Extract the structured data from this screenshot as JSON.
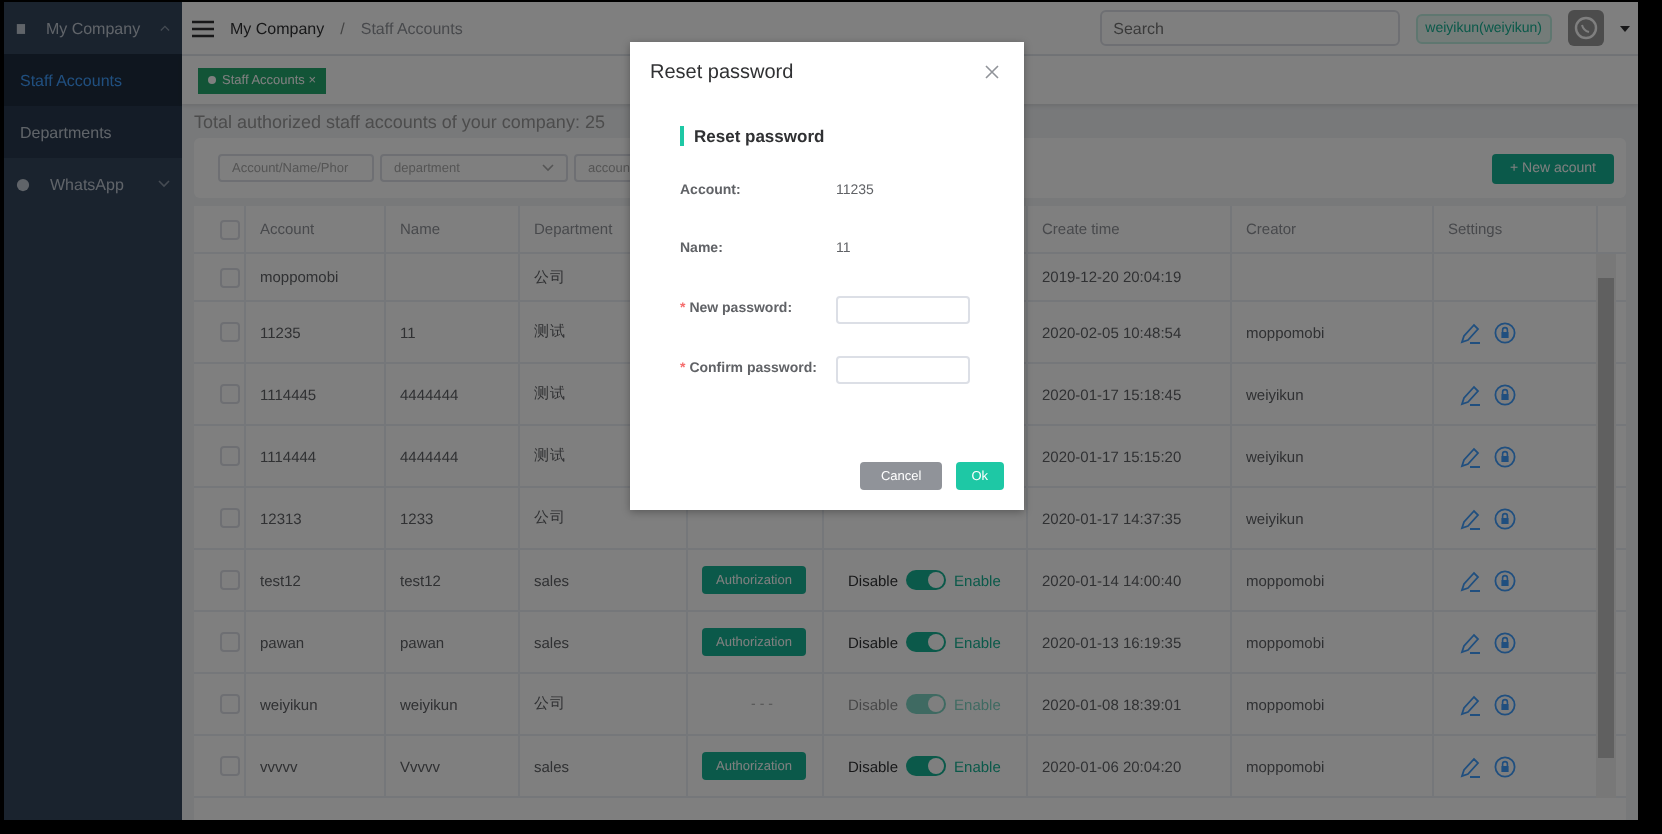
{
  "sidebar": {
    "items": [
      {
        "label": "My Company",
        "kind": "group",
        "expanded": true,
        "selected": false
      },
      {
        "label": "Staff Accounts",
        "kind": "sub",
        "selected": true
      },
      {
        "label": "Departments",
        "kind": "sub",
        "selected": false
      },
      {
        "label": "WhatsApp",
        "kind": "group",
        "expanded": false,
        "selected": false
      }
    ]
  },
  "header": {
    "breadcrumb": [
      "My Company",
      "Staff Accounts"
    ],
    "separator": "/",
    "search": {
      "placeholder": "Search"
    },
    "user": "weiyikun(weiyikun)"
  },
  "tags": [
    {
      "label": "Staff Accounts",
      "close": "×",
      "selected": true
    }
  ],
  "summary": "Total authorized staff accounts of your company: 25",
  "filters": [
    {
      "kind": "input",
      "placeholder": "Account/Name/Phor"
    },
    {
      "kind": "select",
      "placeholder": "department"
    },
    {
      "kind": "input",
      "placeholder": "accoun"
    }
  ],
  "new_button": "+ New acount",
  "table": {
    "all_checked": false,
    "columns": [
      "Account",
      "Name",
      "Department",
      "Create time",
      "Creator",
      "Settings"
    ],
    "rows": [
      {
        "checked": false,
        "account": "moppomobi",
        "name": "",
        "department": "公司",
        "create_time": "2019-12-20 20:04:19",
        "creator": "",
        "actions": false
      },
      {
        "checked": false,
        "account": "11235",
        "name": "11",
        "department": "测试",
        "create_time": "2020-02-05 10:48:54",
        "creator": "moppomobi",
        "actions": true
      },
      {
        "checked": false,
        "account": "1114445",
        "name": "4444444",
        "department": "测试",
        "create_time": "2020-01-17 15:18:45",
        "creator": "weiyikun",
        "actions": true
      },
      {
        "checked": false,
        "account": "1114444",
        "name": "4444444",
        "department": "测试",
        "create_time": "2020-01-17 15:15:20",
        "creator": "weiyikun",
        "actions": true
      },
      {
        "checked": false,
        "account": "12313",
        "name": "1233",
        "department": "公司",
        "create_time": "2020-01-17 14:37:35",
        "creator": "weiyikun",
        "actions": true
      },
      {
        "checked": false,
        "account": "test12",
        "name": "test12",
        "department": "sales",
        "auth": {
          "kind": "button",
          "label": "Authorization"
        },
        "status": {
          "off": "Disable",
          "on_label": "Enable",
          "on": true,
          "disabled": false
        },
        "create_time": "2020-01-14 14:00:40",
        "creator": "moppomobi",
        "actions": true
      },
      {
        "checked": false,
        "account": "pawan",
        "name": "pawan",
        "department": "sales",
        "auth": {
          "kind": "button",
          "label": "Authorization"
        },
        "status": {
          "off": "Disable",
          "on_label": "Enable",
          "on": true,
          "disabled": false
        },
        "create_time": "2020-01-13 16:19:35",
        "creator": "moppomobi",
        "actions": true
      },
      {
        "checked": false,
        "account": "weiyikun",
        "name": "weiyikun",
        "department": "公司",
        "auth": {
          "kind": "text",
          "label": "- - -"
        },
        "status": {
          "off": "Disable",
          "on_label": "Enable",
          "on": true,
          "disabled": true
        },
        "create_time": "2020-01-08 18:39:01",
        "creator": "moppomobi",
        "actions": true
      },
      {
        "checked": false,
        "account": "vvvvv",
        "name": "Vvvvv",
        "department": "sales",
        "auth": {
          "kind": "button",
          "label": "Authorization"
        },
        "status": {
          "off": "Disable",
          "on_label": "Enable",
          "on": true,
          "disabled": false
        },
        "create_time": "2020-01-06 20:04:20",
        "creator": "moppomobi",
        "actions": true
      }
    ]
  },
  "dialog": {
    "title": "Reset password",
    "required_mark": "*",
    "section": "Reset password",
    "fields": [
      {
        "kind": "info",
        "label": "Account:",
        "value": "11235"
      },
      {
        "kind": "info",
        "label": "Name:",
        "value": "11"
      },
      {
        "kind": "input",
        "label": "New password:",
        "required": true
      },
      {
        "kind": "input",
        "label": "Confirm password:",
        "required": true
      }
    ],
    "buttons": [
      {
        "label": "Cancel",
        "kind": "secondary"
      },
      {
        "label": "Ok",
        "kind": "primary"
      }
    ]
  }
}
